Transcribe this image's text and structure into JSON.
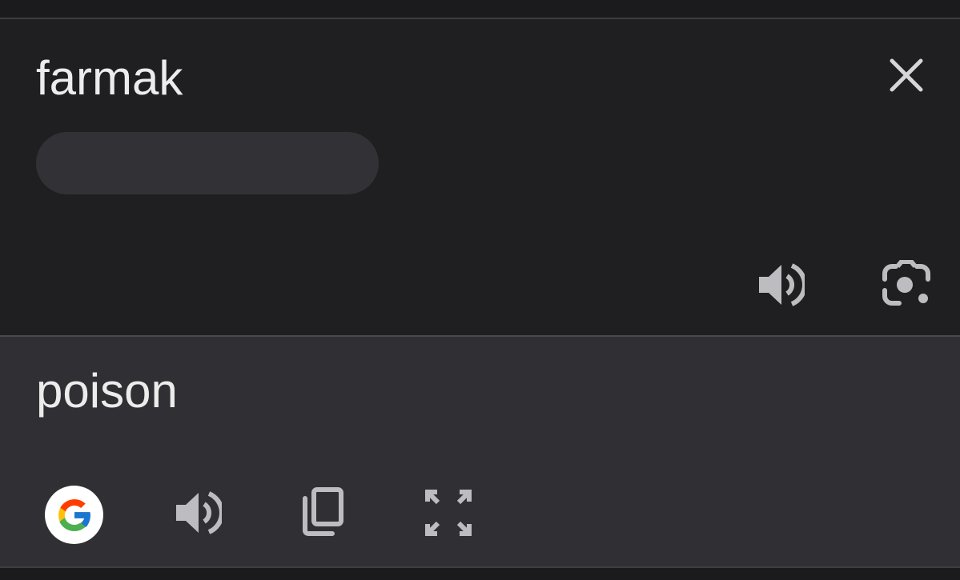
{
  "source": {
    "text": "farmak",
    "close_icon": "close-icon",
    "speaker_icon": "speaker-icon",
    "lens_icon": "camera-lens-icon"
  },
  "target": {
    "text": "poison",
    "logo_icon": "google-logo-icon",
    "speaker_icon": "speaker-icon",
    "copy_icon": "copy-icon",
    "fullscreen_icon": "fullscreen-icon"
  },
  "colors": {
    "source_bg": "#1f1f21",
    "target_bg": "#303034",
    "text": "#ececec",
    "icon": "#bdbdc1"
  }
}
